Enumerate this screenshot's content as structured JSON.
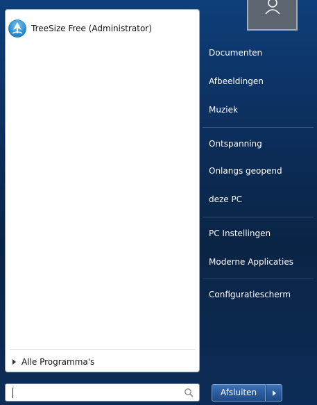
{
  "pinned": {
    "app_label": "TreeSize Free (Administrator)",
    "app_icon": "treesize-icon"
  },
  "all_programs": {
    "label": "Alle Programma's"
  },
  "search": {
    "value": "",
    "icon": "search-icon"
  },
  "user_tile": {
    "icon": "user-icon"
  },
  "right_menu": {
    "items": [
      {
        "label": "Documenten"
      },
      {
        "label": "Afbeeldingen"
      },
      {
        "label": "Muziek"
      },
      {
        "label": "Ontspanning"
      },
      {
        "label": "Onlangs geopend"
      },
      {
        "label": "deze PC"
      },
      {
        "label": "PC Instellingen"
      },
      {
        "label": "Moderne Applicaties"
      },
      {
        "label": "Configuratiescherm"
      }
    ]
  },
  "shutdown": {
    "label": "Afsluiten",
    "arrow_icon": "triangle-right-icon"
  }
}
